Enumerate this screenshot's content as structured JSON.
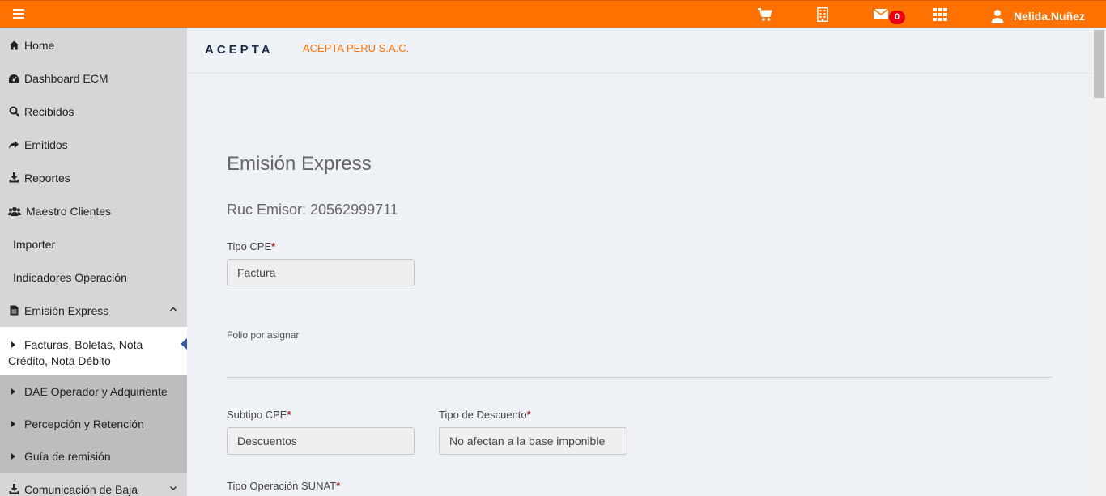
{
  "topbar": {
    "mail_count": "0",
    "username": "Nelida.Nuñez",
    "icons": [
      "menu-icon",
      "cart-icon",
      "building-icon",
      "mail-icon",
      "apps-grid-icon",
      "user-icon"
    ],
    "color": "#ff7100"
  },
  "sidebar": {
    "items": [
      {
        "label": "Home",
        "icon": "home-icon"
      },
      {
        "label": "Dashboard ECM",
        "icon": "dashboard-icon"
      },
      {
        "label": "Recibidos",
        "icon": "search-icon"
      },
      {
        "label": "Emitidos",
        "icon": "share-arrow-icon"
      },
      {
        "label": "Reportes",
        "icon": "download-icon"
      },
      {
        "label": "Maestro Clientes",
        "icon": "users-icon"
      },
      {
        "label": "Importer"
      },
      {
        "label": "Indicadores Operación"
      },
      {
        "label": "Emisión Express",
        "icon": "file-icon",
        "expanded": true
      }
    ],
    "subitems": [
      {
        "label": "Facturas, Boletas, Nota Crédito, Nota Débito",
        "active": true
      },
      {
        "label": "DAE Operador y Adquiriente"
      },
      {
        "label": "Percepción y Retención"
      },
      {
        "label": "Guía de remisión"
      }
    ],
    "bottom_item": {
      "label": "Comunicación de Baja",
      "icon": "download-icon"
    }
  },
  "brand": {
    "logo": "ACEPTA",
    "company": "ACEPTA PERU S.A.C."
  },
  "form": {
    "title": "Emisión Express",
    "ruc": "Ruc Emisor: 20562999711",
    "tipo_cpe": {
      "label": "Tipo CPE",
      "value": "Factura"
    },
    "folio": "Folio por asignar",
    "subtipo_cpe": {
      "label": "Subtipo CPE",
      "value": "Descuentos"
    },
    "tipo_descuento": {
      "label": "Tipo de Descuento",
      "value": "No afectan a la base imponible"
    },
    "tipo_operacion": {
      "label": "Tipo Operación SUNAT"
    },
    "required_mark": "*"
  }
}
